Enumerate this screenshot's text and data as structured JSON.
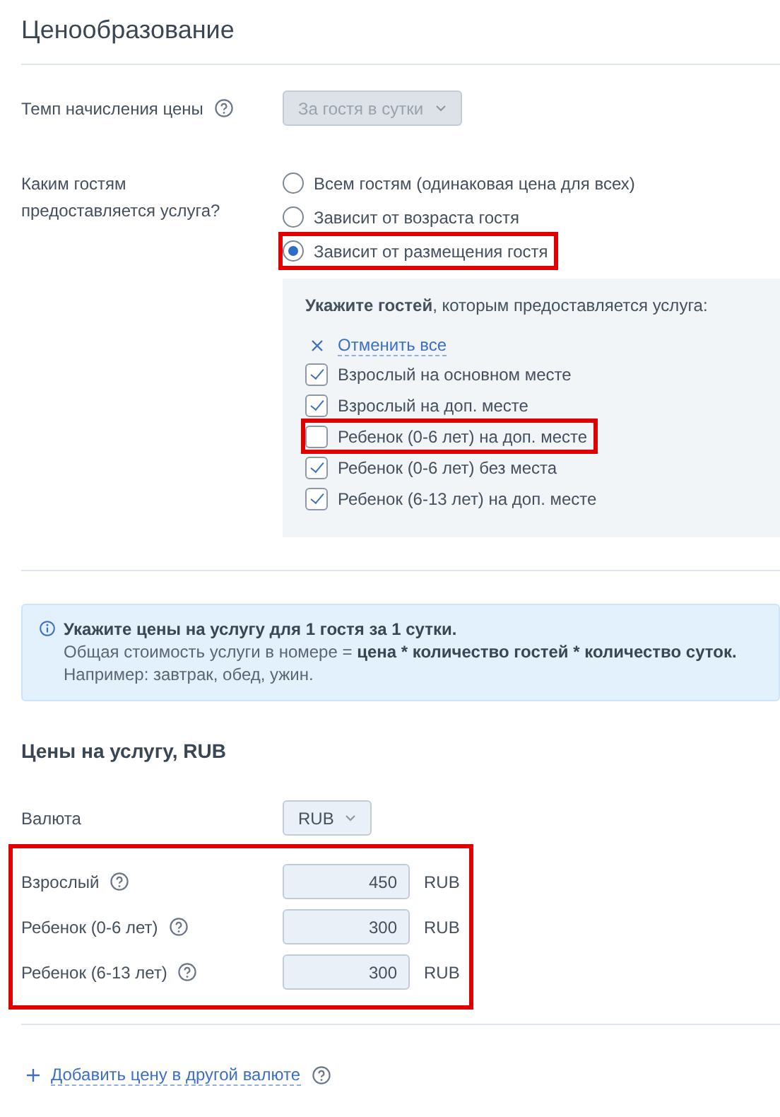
{
  "title": "Ценообразование",
  "rate": {
    "label": "Темп начисления цены",
    "value": "За гостя в сутки",
    "disabled": true
  },
  "guests": {
    "label": "Каким гостям предоставляется услуга?",
    "options": [
      {
        "label": "Всем гостям (одинаковая цена для всех)",
        "selected": false,
        "highlighted": false
      },
      {
        "label": "Зависит от возраста гостя",
        "selected": false,
        "highlighted": false
      },
      {
        "label": "Зависит от размещения гостя",
        "selected": true,
        "highlighted": true
      }
    ],
    "panel": {
      "prompt": "**Укажите гостей**, которым предоставляется услуга:",
      "clear_all": "Отменить все",
      "items": [
        {
          "label": "Взрослый на основном месте",
          "checked": true,
          "highlighted": false
        },
        {
          "label": "Взрослый на доп. месте",
          "checked": true,
          "highlighted": false
        },
        {
          "label": "Ребенок (0-6 лет) на доп. месте",
          "checked": false,
          "highlighted": true
        },
        {
          "label": "Ребенок (0-6 лет) без места",
          "checked": true,
          "highlighted": false
        },
        {
          "label": "Ребенок (6-13 лет) на доп. месте",
          "checked": true,
          "highlighted": false
        }
      ]
    }
  },
  "info": {
    "lines": [
      "**Укажите цены на услугу для 1 гостя за 1 сутки.**",
      "Общая стоимость услуги в номере = **цена * количество гостей * количество суток.**",
      "Например: завтрак, обед, ужин."
    ]
  },
  "prices": {
    "heading": "Цены на услугу, RUB",
    "currency_label": "Валюта",
    "currency": "RUB",
    "highlighted": true,
    "rows": [
      {
        "label": "Взрослый",
        "value": "450",
        "unit": "RUB"
      },
      {
        "label": "Ребенок (0-6 лет)",
        "value": "300",
        "unit": "RUB"
      },
      {
        "label": "Ребенок (6-13 лет)",
        "value": "300",
        "unit": "RUB"
      }
    ]
  },
  "add_currency": "Добавить цену в другой валюте"
}
